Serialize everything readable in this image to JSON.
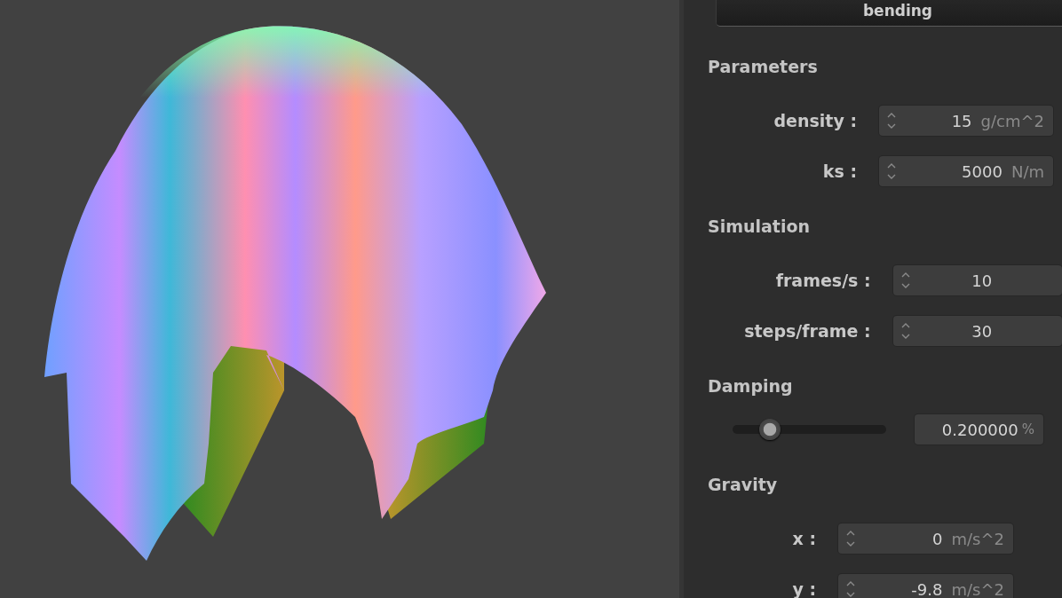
{
  "panel": {
    "top_button": "bending",
    "sections": [
      {
        "title": "Parameters",
        "kind": "spin",
        "fields": [
          {
            "label": "density :",
            "value": "15",
            "unit": "g/cm^2"
          },
          {
            "label": "ks :",
            "value": "5000",
            "unit": "N/m"
          }
        ]
      },
      {
        "title": "Simulation",
        "kind": "spin",
        "fields": [
          {
            "label": "frames/s :",
            "value": "10"
          },
          {
            "label": "steps/frame :",
            "value": "30"
          }
        ]
      },
      {
        "title": "Damping",
        "kind": "slider",
        "level": 0.2,
        "value": "0.200000",
        "unit": "%"
      },
      {
        "title": "Gravity",
        "kind": "spin",
        "fields": [
          {
            "label": "x :",
            "value": "0",
            "unit": "m/s^2"
          },
          {
            "label": "y :",
            "value": "-9.8",
            "unit": "m/s^2"
          }
        ]
      }
    ]
  }
}
